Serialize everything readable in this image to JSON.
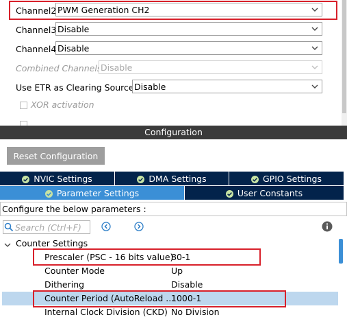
{
  "mode": {
    "channel2": {
      "label": "Channel2",
      "value": "PWM Generation CH2"
    },
    "channel3": {
      "label": "Channel3",
      "value": "Disable"
    },
    "channel4": {
      "label": "Channel4",
      "value": "Disable"
    },
    "combined": {
      "label": "Combined Channels",
      "value": "Disable"
    },
    "etr": {
      "label": "Use ETR as Clearing Source",
      "value": "Disable"
    },
    "xor": {
      "label": "XOR activation"
    }
  },
  "config": {
    "title": "Configuration",
    "reset_label": "Reset Configuration",
    "tabs_row1": [
      {
        "label": "NVIC Settings"
      },
      {
        "label": "DMA Settings"
      },
      {
        "label": "GPIO Settings"
      }
    ],
    "tabs_row2": [
      {
        "label": "Parameter Settings",
        "active": true
      },
      {
        "label": "User Constants"
      }
    ],
    "param_header": "Configure the below parameters :",
    "search_placeholder": "Search (Ctrl+F)"
  },
  "tree": {
    "group_label": "Counter Settings",
    "rows": [
      {
        "key": "Prescaler (PSC - 16 bits value)",
        "value": "80-1"
      },
      {
        "key": "Counter Mode",
        "value": "Up"
      },
      {
        "key": "Dithering",
        "value": "Disable"
      },
      {
        "key": "Counter Period (AutoReload ...",
        "value": "1000-1",
        "selected": true
      },
      {
        "key": "Internal Clock Division (CKD)",
        "value": "No Division"
      }
    ]
  },
  "colors": {
    "highlight": "#d8202a",
    "tab_dark": "#03234b",
    "tab_active": "#3b8fd6",
    "row_selected": "#bdd7ee"
  },
  "icons": [
    "chevron-down-icon",
    "checkmark-circle-icon",
    "search-icon",
    "arrow-left-circle-icon",
    "arrow-right-circle-icon",
    "info-icon",
    "caret-down-icon"
  ]
}
